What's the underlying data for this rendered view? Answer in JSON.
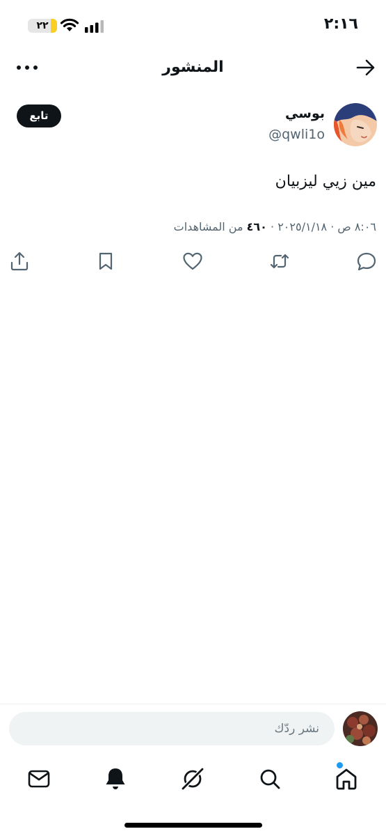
{
  "status_bar": {
    "time": "٢:١٦",
    "battery_level": "٢٢",
    "battery_fraction": 0.22
  },
  "header": {
    "title": "المنشور",
    "back_icon": "arrow-right-icon",
    "more_icon": "ellipsis-icon"
  },
  "post": {
    "author_name": "بوسي",
    "author_handle": "@qwli1o",
    "follow_label": "تابع",
    "text": "مين زيي ليزبيان",
    "timestamp": "٨:٠٦ ص · ٢٠٢٥/١/١٨ · ",
    "views_count": "٤٦٠",
    "views_label": " من المشاهدات"
  },
  "actions": [
    "reply-icon",
    "repost-icon",
    "like-icon",
    "bookmark-icon",
    "share-icon"
  ],
  "reply_bar": {
    "placeholder": "نشر ردّك"
  },
  "tabbar": {
    "items": [
      "home-icon",
      "search-icon",
      "grok-icon",
      "notifications-icon",
      "messages-icon"
    ],
    "accent_color": "#1d9bf0"
  }
}
